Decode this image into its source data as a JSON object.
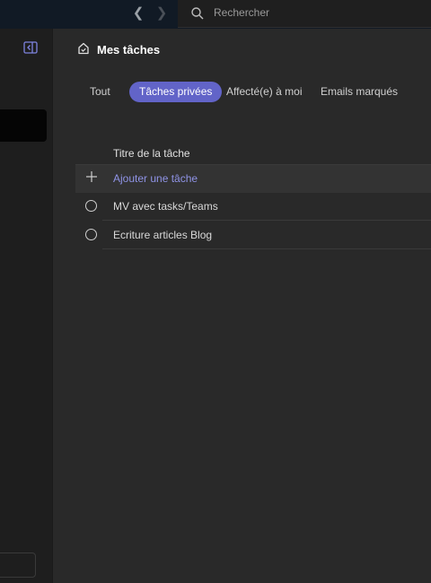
{
  "search": {
    "placeholder": "Rechercher"
  },
  "header": {
    "title": "Mes tâches"
  },
  "tabs": [
    {
      "label": "Tout"
    },
    {
      "label": "Tâches privées"
    },
    {
      "label": "Affecté(e) à moi"
    },
    {
      "label": "Emails marqués"
    }
  ],
  "active_tab": "Tâches privées",
  "table": {
    "column_header": "Titre de la tâche",
    "add_label": "Ajouter une tâche",
    "tasks": [
      {
        "title": "MV avec tasks/Teams"
      },
      {
        "title": "Ecriture articles Blog"
      }
    ]
  },
  "colors": {
    "accent": "#6264c8",
    "background": "#292929",
    "topbar": "#111a25"
  }
}
